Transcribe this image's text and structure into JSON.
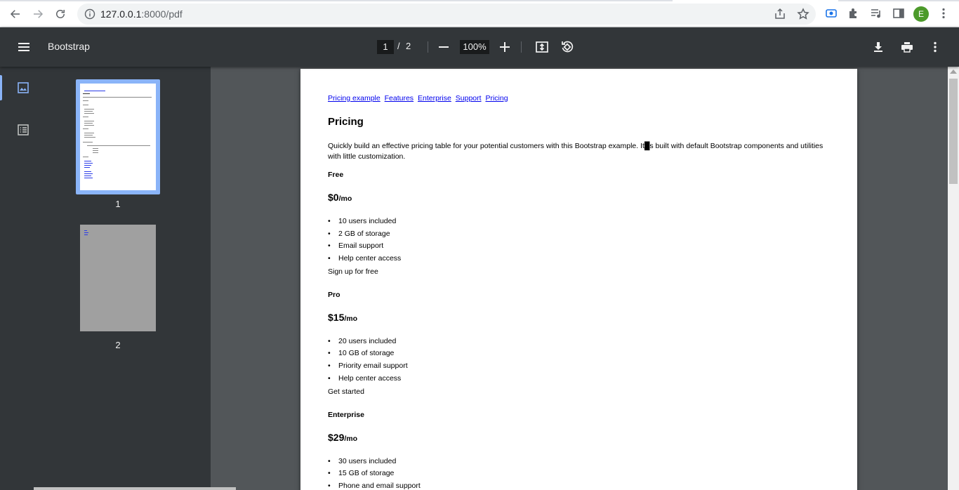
{
  "browser": {
    "url_host": "127.0.0.1",
    "url_path": ":8000/pdf",
    "avatar_letter": "E"
  },
  "toolbar": {
    "title": "Bootstrap",
    "current_page": "1",
    "page_sep": "/",
    "total_pages": "2",
    "zoom": "100%"
  },
  "sidebar": {
    "thumbnails": [
      {
        "label": "1"
      },
      {
        "label": "2"
      }
    ]
  },
  "document": {
    "nav_links": [
      "Pricing example",
      "Features",
      "Enterprise",
      "Support",
      "Pricing"
    ],
    "heading": "Pricing",
    "intro": "Quickly build an effective pricing table for your potential customers with this Bootstrap example. It█s built with default Bootstrap components and utilities with little customization.",
    "plans": [
      {
        "name": "Free",
        "price": "$0",
        "period": "/mo",
        "features": [
          "10 users included",
          "2 GB of storage",
          "Email support",
          "Help center access"
        ],
        "cta": "Sign up for free"
      },
      {
        "name": "Pro",
        "price": "$15",
        "period": "/mo",
        "features": [
          "20 users included",
          "10 GB of storage",
          "Priority email support",
          "Help center access"
        ],
        "cta": "Get started"
      },
      {
        "name": "Enterprise",
        "price": "$29",
        "period": "/mo",
        "features": [
          "30 users included",
          "15 GB of storage",
          "Phone and email support"
        ]
      }
    ]
  },
  "colors": {
    "toolbar_bg": "#323639",
    "viewer_bg": "#525659",
    "accent": "#8ab4f8",
    "link": "#0000ee"
  }
}
